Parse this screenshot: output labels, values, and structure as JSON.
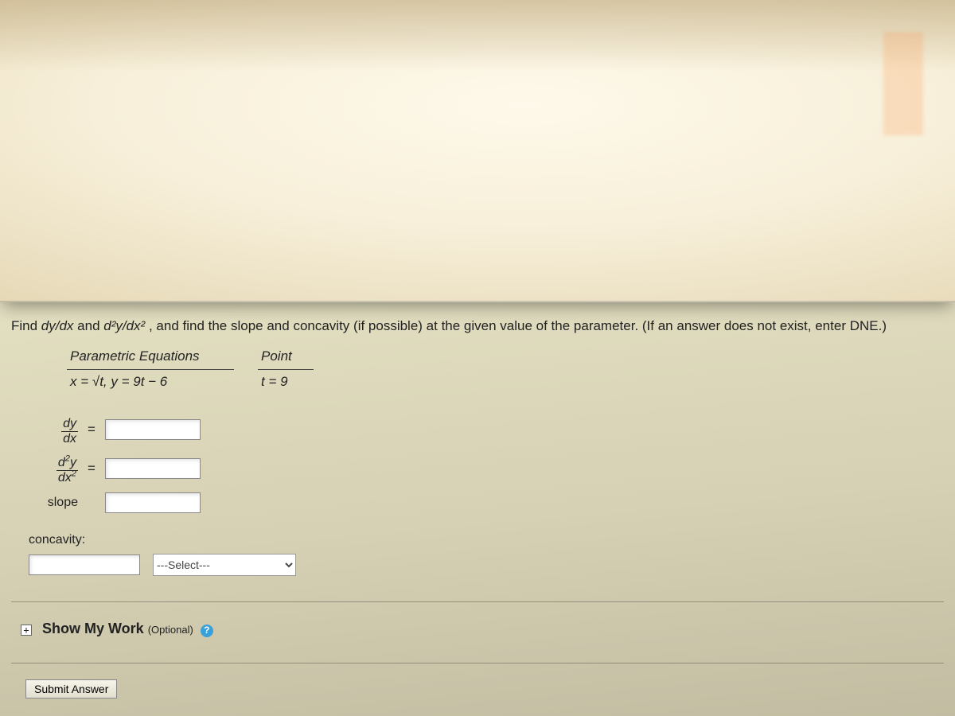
{
  "prompt": {
    "prefix": "Find ",
    "dy": "dy/dx",
    "and": " and ",
    "d2y": "d²y/dx²",
    "suffix": ",  and find the slope and concavity (if possible) at the given value of the parameter. (If an answer does not exist, enter DNE.)"
  },
  "table": {
    "header_param": "Parametric Equations",
    "header_point": "Point",
    "equations": "x = √t,  y = 9t − 6",
    "point": "t = 9"
  },
  "answers": {
    "dy_label": {
      "num": "dy",
      "den": "dx"
    },
    "d2y_label": {
      "num": "d²y",
      "den": "dx²"
    },
    "slope_label": "slope",
    "equals": "="
  },
  "concavity": {
    "label": "concavity:",
    "select_placeholder": "---Select---"
  },
  "show_work": {
    "expand": "+",
    "title": "Show My Work",
    "optional": "(Optional)",
    "help": "?"
  },
  "submit": "Submit Answer"
}
